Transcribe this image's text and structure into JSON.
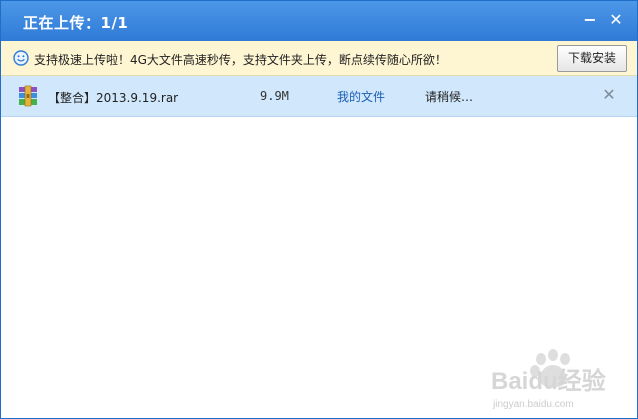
{
  "window": {
    "title": "正在上传：1/1",
    "minimize_glyph": "−",
    "close_glyph": "✕"
  },
  "notice": {
    "icon": "smiley-icon",
    "text": "支持极速上传啦！4G大文件高速秒传，支持文件夹上传，断点续传随心所欲！",
    "install_label": "下载安装"
  },
  "upload_list": [
    {
      "icon": "rar-archive-icon",
      "name": "【整合】2013.9.19.rar",
      "size": "9.9M",
      "destination": "我的文件",
      "status": "请稍候…",
      "remove_glyph": "✕"
    }
  ],
  "watermark": {
    "brand": "Baidu经验",
    "url": "jingyan.baidu.com"
  },
  "colors": {
    "titlebar": "#3a86dd",
    "notice_bg": "#fef5d3",
    "row_selected": "#d1e8fc",
    "link": "#1a5fb4"
  }
}
